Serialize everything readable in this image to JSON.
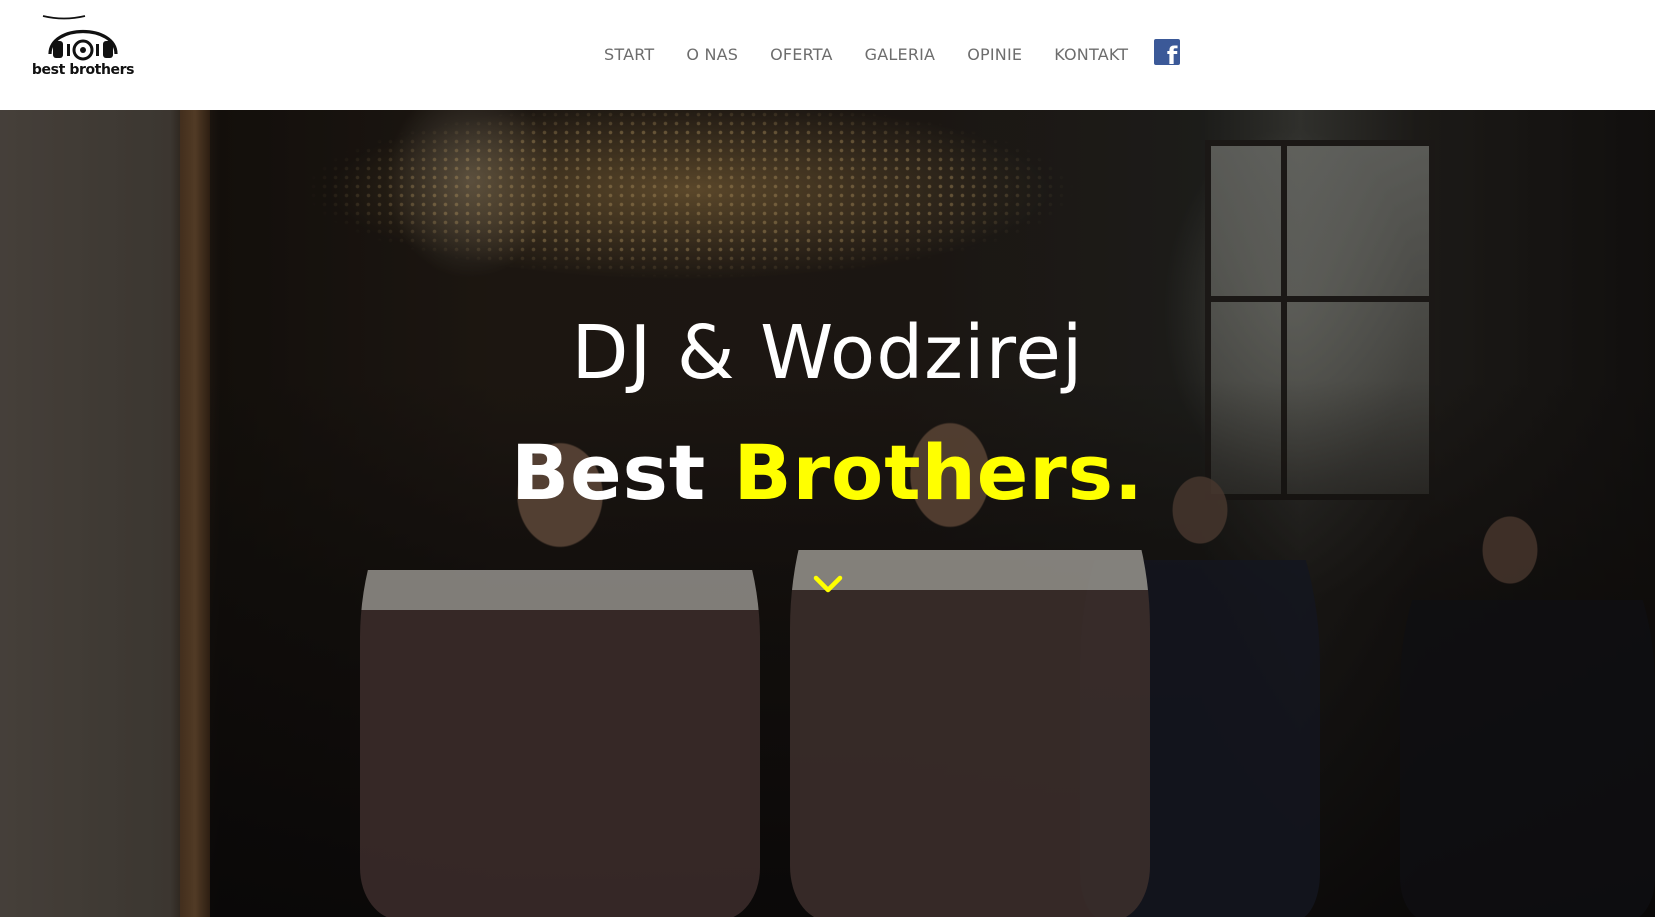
{
  "brand": {
    "logo_text": "best brothers"
  },
  "nav": {
    "items": [
      {
        "label": "START"
      },
      {
        "label": "O NAS"
      },
      {
        "label": "OFERTA"
      },
      {
        "label": "GALERIA"
      },
      {
        "label": "OPINIE"
      },
      {
        "label": "KONTAKT"
      }
    ],
    "social_icon": "facebook-icon"
  },
  "hero": {
    "title": "DJ & Wodzirej",
    "subtitle_main": "Best ",
    "subtitle_accent": "Brothers.",
    "scroll_icon": "chevron-down-icon"
  },
  "colors": {
    "accent": "#ffff00",
    "nav_text": "#6d6d6d",
    "facebook": "#3b5998"
  }
}
